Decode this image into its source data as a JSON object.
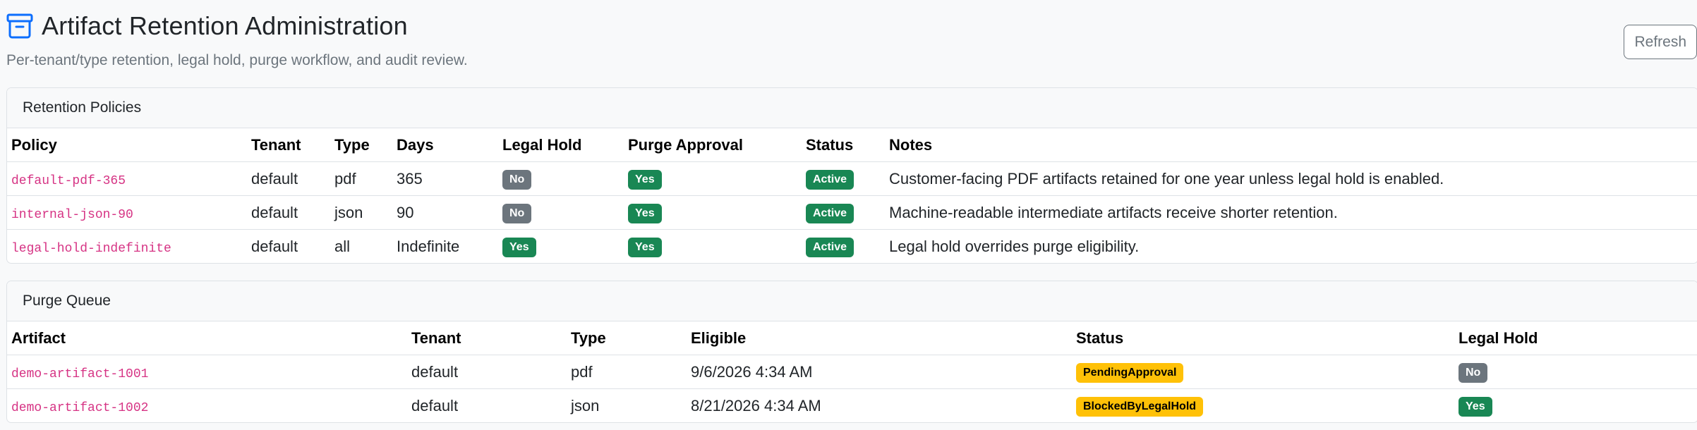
{
  "header": {
    "title": "Artifact Retention Administration",
    "subtitle": "Per-tenant/type retention, legal hold, purge workflow, and audit review.",
    "refresh_label": "Refresh",
    "icon": "archive-icon"
  },
  "policies": {
    "title": "Retention Policies",
    "columns": [
      "Policy",
      "Tenant",
      "Type",
      "Days",
      "Legal Hold",
      "Purge Approval",
      "Status",
      "Notes"
    ],
    "rows": [
      {
        "policy": "default-pdf-365",
        "tenant": "default",
        "type": "pdf",
        "days": "365",
        "legal_hold": "No",
        "purge_approval": "Yes",
        "status": "Active",
        "notes": "Customer-facing PDF artifacts retained for one year unless legal hold is enabled."
      },
      {
        "policy": "internal-json-90",
        "tenant": "default",
        "type": "json",
        "days": "90",
        "legal_hold": "No",
        "purge_approval": "Yes",
        "status": "Active",
        "notes": "Machine-readable intermediate artifacts receive shorter retention."
      },
      {
        "policy": "legal-hold-indefinite",
        "tenant": "default",
        "type": "all",
        "days": "Indefinite",
        "legal_hold": "Yes",
        "purge_approval": "Yes",
        "status": "Active",
        "notes": "Legal hold overrides purge eligibility."
      }
    ]
  },
  "purge": {
    "title": "Purge Queue",
    "columns": [
      "Artifact",
      "Tenant",
      "Type",
      "Eligible",
      "Status",
      "Legal Hold"
    ],
    "rows": [
      {
        "artifact": "demo-artifact-1001",
        "tenant": "default",
        "type": "pdf",
        "eligible": "9/6/2026 4:34 AM",
        "status": "PendingApproval",
        "legal_hold": "No"
      },
      {
        "artifact": "demo-artifact-1002",
        "tenant": "default",
        "type": "json",
        "eligible": "8/21/2026 4:34 AM",
        "status": "BlockedByLegalHold",
        "legal_hold": "Yes"
      }
    ]
  },
  "colors": {
    "badge_no": "#6c757d",
    "badge_yes": "#198754",
    "badge_warning": "#ffc107",
    "code_text": "#d63384",
    "icon": "#0d6efd"
  }
}
